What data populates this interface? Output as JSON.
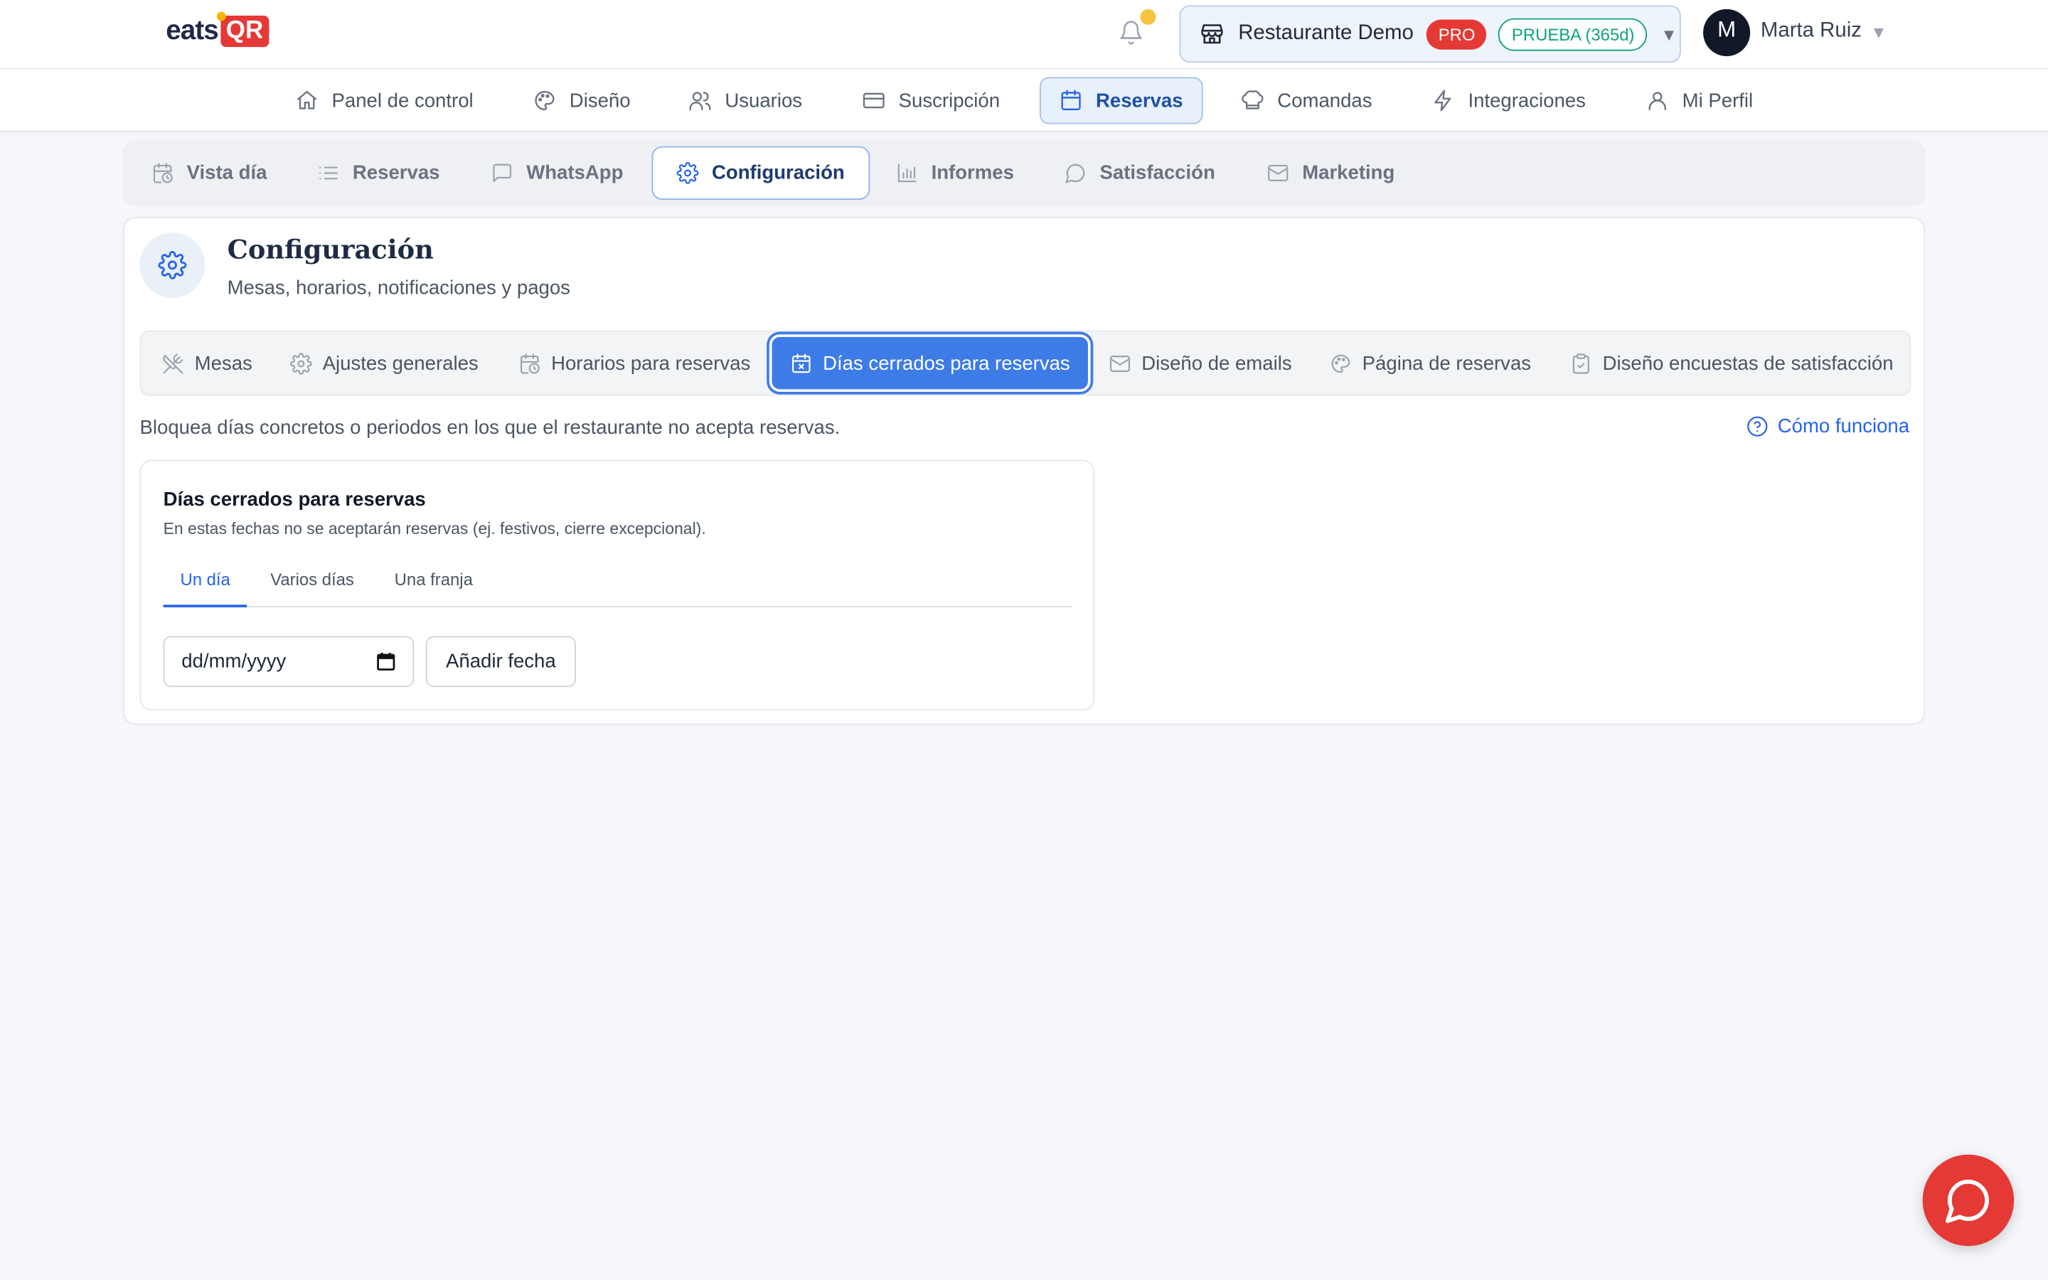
{
  "brand": {
    "logo_left": "eats",
    "logo_right": "QR"
  },
  "header": {
    "restaurant_name": "Restaurante Demo",
    "plan_badge": "PRO",
    "trial_badge": "PRUEBA (365d)",
    "caret": "▼",
    "user_initial": "M",
    "user_name": "Marta Ruiz",
    "user_caret": "▼"
  },
  "main_nav": {
    "items": [
      {
        "label": "Panel de control",
        "icon": "home-icon"
      },
      {
        "label": "Diseño",
        "icon": "palette-icon"
      },
      {
        "label": "Usuarios",
        "icon": "users-icon"
      },
      {
        "label": "Suscripción",
        "icon": "credit-card-icon"
      },
      {
        "label": "Reservas",
        "icon": "calendar-icon",
        "active": true
      },
      {
        "label": "Comandas",
        "icon": "chef-hat-icon"
      },
      {
        "label": "Integraciones",
        "icon": "bolt-icon"
      },
      {
        "label": "Mi Perfil",
        "icon": "user-icon"
      }
    ]
  },
  "sub_tabs": {
    "items": [
      {
        "label": "Vista día",
        "icon": "calendar-clock-icon"
      },
      {
        "label": "Reservas",
        "icon": "list-icon"
      },
      {
        "label": "WhatsApp",
        "icon": "message-square-icon"
      },
      {
        "label": "Configuración",
        "icon": "gear-icon",
        "active": true
      },
      {
        "label": "Informes",
        "icon": "bar-chart-icon"
      },
      {
        "label": "Satisfacción",
        "icon": "message-circle-icon"
      },
      {
        "label": "Marketing",
        "icon": "mail-icon"
      }
    ]
  },
  "config": {
    "title": "Configuración",
    "subtitle": "Mesas, horarios, notificaciones y pagos",
    "tabs": [
      {
        "label": "Mesas",
        "icon": "utensils-crossed-icon"
      },
      {
        "label": "Ajustes generales",
        "icon": "gear-icon"
      },
      {
        "label": "Horarios para reservas",
        "icon": "calendar-clock-icon"
      },
      {
        "label": "Días cerrados para reservas",
        "icon": "calendar-x-icon",
        "active": true
      },
      {
        "label": "Diseño de emails",
        "icon": "mail-icon"
      },
      {
        "label": "Página de reservas",
        "icon": "palette-icon"
      },
      {
        "label": "Diseño encuestas de satisfacción",
        "icon": "clipboard-check-icon"
      }
    ],
    "description": "Bloquea días concretos o periodos en los que el restaurante no acepta reservas.",
    "how_it_works": "Cómo funciona"
  },
  "closed_days": {
    "title": "Días cerrados para reservas",
    "subtitle": "En estas fechas no se aceptarán reservas (ej. festivos, cierre excepcional).",
    "modes": [
      {
        "label": "Un día",
        "active": true
      },
      {
        "label": "Varios días"
      },
      {
        "label": "Una franja"
      }
    ],
    "date_placeholder": "dd/mm/yyyy",
    "add_button": "Añadir fecha"
  },
  "colors": {
    "accent": "#2563eb",
    "brand_red": "#e53935",
    "trial_green": "#10a37f",
    "active_tab_fill": "#3d7be6"
  }
}
